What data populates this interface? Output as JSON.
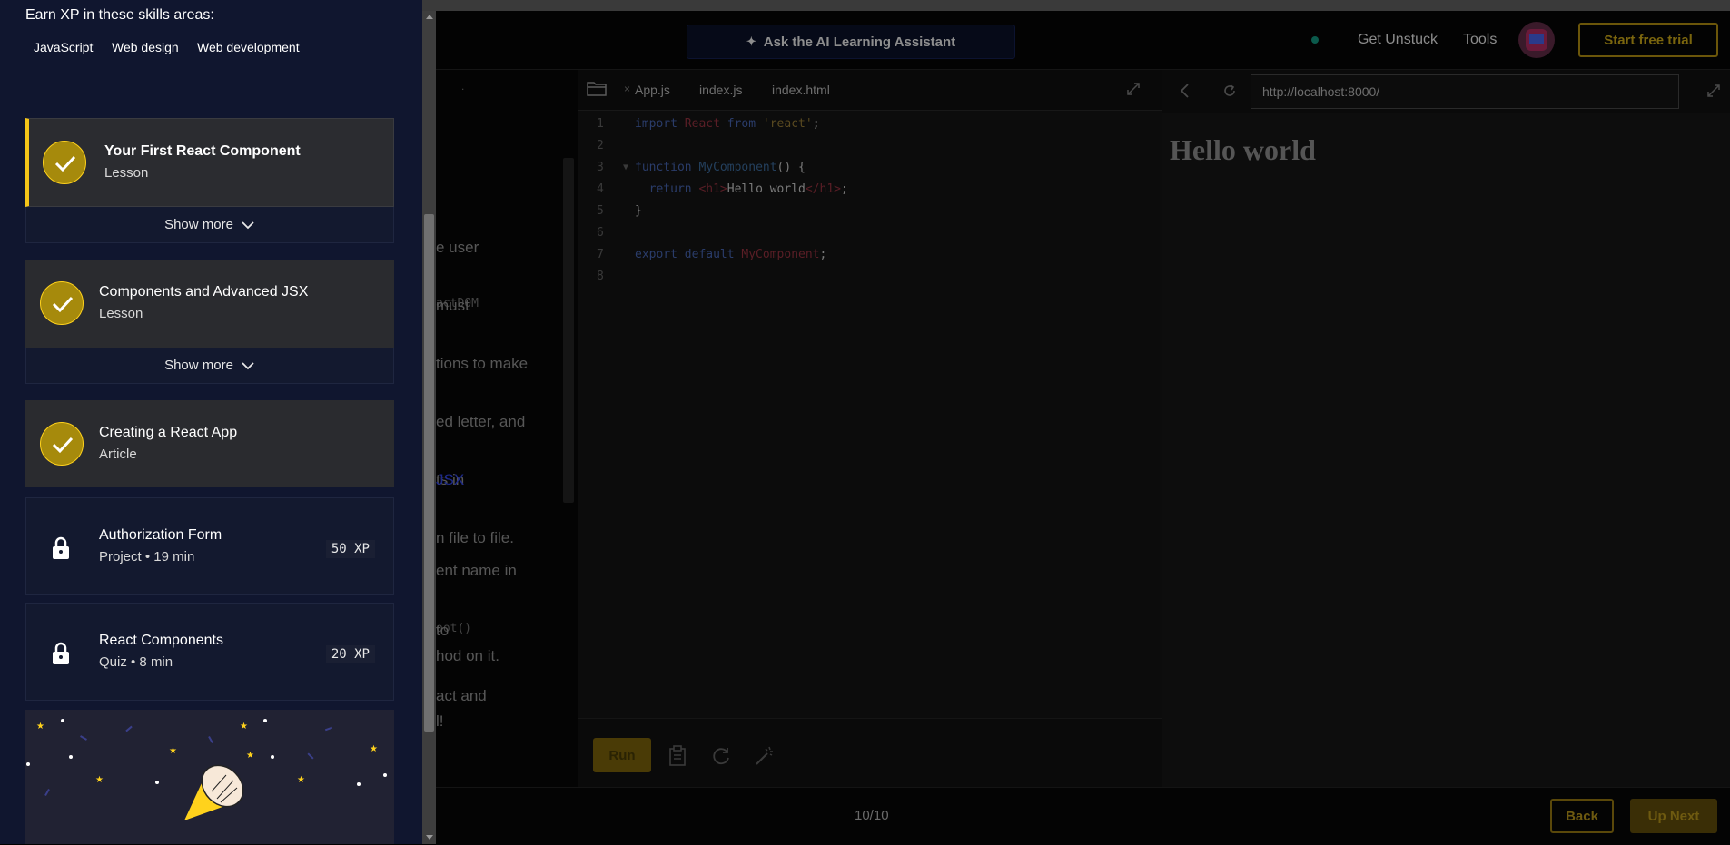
{
  "header": {
    "ai_assistant_label": "Ask the AI Learning Assistant",
    "get_unstuck": "Get Unstuck",
    "tools": "Tools",
    "start_trial": "Start free trial"
  },
  "lesson_text": {
    "frag1": "e user",
    "frag2": "actDOM",
    "frag2b": "must",
    "frag3": "tions to make",
    "frag4": "ed letter, and",
    "frag5": "ts in",
    "frag5_link": "JSX",
    "frag6": "n file to file.",
    "frag7": "ent name in",
    "frag8": "oot()",
    "frag8b": "to",
    "frag9": "hod on it.",
    "frag10": "act and",
    "frag11": "l!"
  },
  "editor": {
    "tabs": [
      "App.js",
      "index.js",
      "index.html"
    ],
    "tab_close": "×",
    "line_numbers": [
      "1",
      "2",
      "3",
      "4",
      "5",
      "6",
      "7",
      "8"
    ],
    "code": {
      "l1_kw1": "import",
      "l1_var": "React",
      "l1_kw2": "from",
      "l1_str": "'react'",
      "l1_end": ";",
      "l3_kw": "function",
      "l3_fn": "MyComponent",
      "l3_end": "() {",
      "l4_kw": "return",
      "l4_open": "<h1>",
      "l4_text": "Hello world",
      "l4_close": "</h1>",
      "l4_end": ";",
      "l5": "}",
      "l7_kw": "export default",
      "l7_var": "MyComponent",
      "l7_end": ";"
    },
    "run_label": "Run"
  },
  "browser": {
    "url": "http://localhost:8000/",
    "heading": "Hello world"
  },
  "footer": {
    "counter": "10/10",
    "back": "Back",
    "next": "Up Next"
  },
  "panel": {
    "skills_title": "Earn XP in these skills areas:",
    "skills": [
      "JavaScript",
      "Web design",
      "Web development"
    ],
    "show_more": "Show more",
    "items": [
      {
        "title": "Your First React Component",
        "subtitle": "Lesson"
      },
      {
        "title": "Components and Advanced JSX",
        "subtitle": "Lesson"
      },
      {
        "title": "Creating a React App",
        "subtitle": "Article"
      },
      {
        "title": "Authorization Form",
        "subtitle": "Project • 19 min",
        "xp": "50 XP"
      },
      {
        "title": "React Components",
        "subtitle": "Quiz • 8 min",
        "xp": "20 XP"
      }
    ]
  },
  "colors": {
    "panel_bg": "#10162f",
    "accent_yellow": "#f5c518",
    "check_fill": "#a68a0c",
    "card_bg": "#2a2b2f"
  },
  "icons": [
    "sparkle-icon",
    "folder-icon",
    "expand-icon",
    "back-arrow-icon",
    "refresh-icon",
    "clipboard-icon",
    "reset-icon",
    "magic-wand-icon",
    "check-icon",
    "chevron-down-icon",
    "lock-icon",
    "party-popper-icon"
  ]
}
